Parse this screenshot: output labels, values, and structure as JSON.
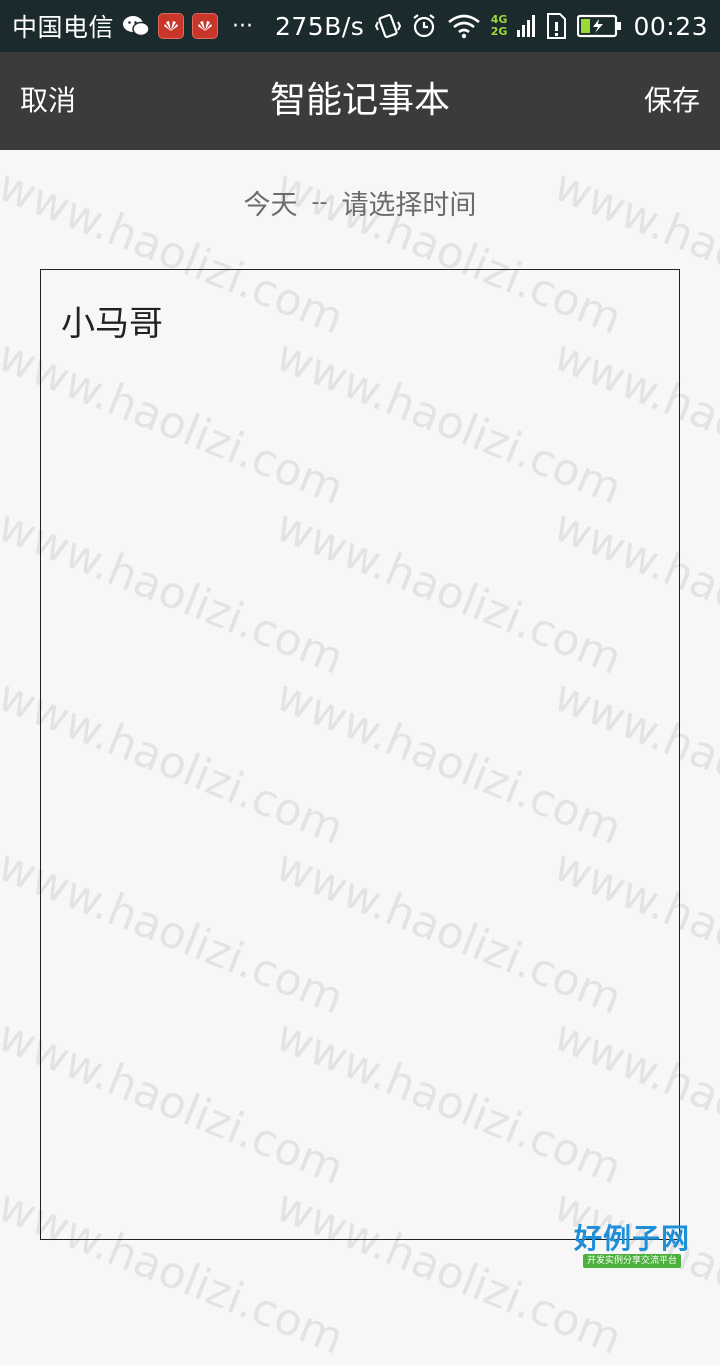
{
  "status_bar": {
    "carrier": "中国电信",
    "dots": "···",
    "speed": "275B/s",
    "net_4g": "4G",
    "net_2g": "2G",
    "time": "00:23",
    "icons": [
      "wechat-icon",
      "huawei-app-icon",
      "huawei-app-icon",
      "vibrate-icon",
      "alarm-icon",
      "wifi-icon",
      "signal-icon",
      "sim-icon",
      "battery-charging-icon"
    ]
  },
  "title_bar": {
    "cancel_label": "取消",
    "title": "智能记事本",
    "save_label": "保存"
  },
  "date_row": {
    "day": "今天",
    "separator": "--",
    "time_prompt": "请选择时间"
  },
  "editor": {
    "content": "小马哥"
  },
  "watermark": {
    "text": "www.haolizi.com"
  },
  "logo": {
    "title": "好例子网",
    "subtitle": "开发实例分享交流平台"
  },
  "colors": {
    "status_bg": "#1b2a2c",
    "title_bg": "#3b3b3b",
    "page_bg": "#f7f7f7",
    "logo_blue": "#1e8fd8",
    "logo_green": "#4cb13c"
  }
}
